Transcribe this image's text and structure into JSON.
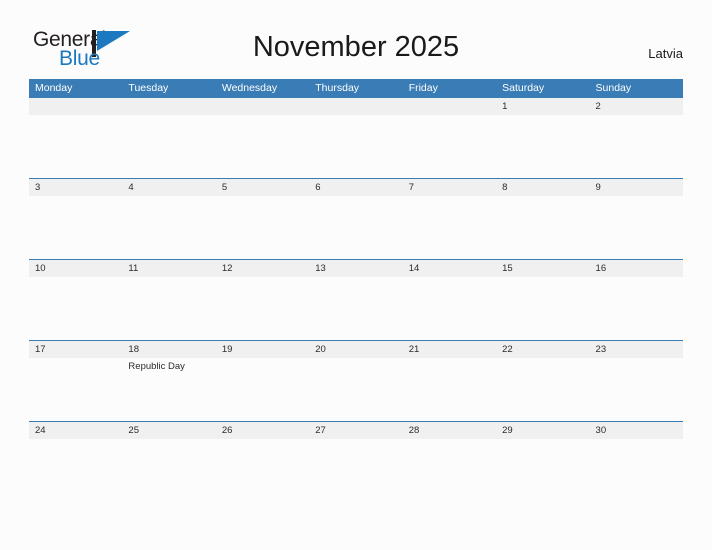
{
  "brand": {
    "name_dark": "General",
    "name_blue": "Blue",
    "accent_color": "#1c79c0",
    "mark_icon": "triangle-flag-icon"
  },
  "header": {
    "title": "November 2025",
    "country": "Latvia"
  },
  "colors": {
    "header_bar": "#3a7cb5",
    "date_band": "#f0f0f0",
    "page_background": "#fcfcfd",
    "text": "#2b2b2b"
  },
  "calendar": {
    "weekdays": [
      "Monday",
      "Tuesday",
      "Wednesday",
      "Thursday",
      "Friday",
      "Saturday",
      "Sunday"
    ],
    "weeks": [
      [
        {
          "date": "",
          "event": ""
        },
        {
          "date": "",
          "event": ""
        },
        {
          "date": "",
          "event": ""
        },
        {
          "date": "",
          "event": ""
        },
        {
          "date": "",
          "event": ""
        },
        {
          "date": "1",
          "event": ""
        },
        {
          "date": "2",
          "event": ""
        }
      ],
      [
        {
          "date": "3",
          "event": ""
        },
        {
          "date": "4",
          "event": ""
        },
        {
          "date": "5",
          "event": ""
        },
        {
          "date": "6",
          "event": ""
        },
        {
          "date": "7",
          "event": ""
        },
        {
          "date": "8",
          "event": ""
        },
        {
          "date": "9",
          "event": ""
        }
      ],
      [
        {
          "date": "10",
          "event": ""
        },
        {
          "date": "11",
          "event": ""
        },
        {
          "date": "12",
          "event": ""
        },
        {
          "date": "13",
          "event": ""
        },
        {
          "date": "14",
          "event": ""
        },
        {
          "date": "15",
          "event": ""
        },
        {
          "date": "16",
          "event": ""
        }
      ],
      [
        {
          "date": "17",
          "event": ""
        },
        {
          "date": "18",
          "event": "Republic Day"
        },
        {
          "date": "19",
          "event": ""
        },
        {
          "date": "20",
          "event": ""
        },
        {
          "date": "21",
          "event": ""
        },
        {
          "date": "22",
          "event": ""
        },
        {
          "date": "23",
          "event": ""
        }
      ],
      [
        {
          "date": "24",
          "event": ""
        },
        {
          "date": "25",
          "event": ""
        },
        {
          "date": "26",
          "event": ""
        },
        {
          "date": "27",
          "event": ""
        },
        {
          "date": "28",
          "event": ""
        },
        {
          "date": "29",
          "event": ""
        },
        {
          "date": "30",
          "event": ""
        }
      ]
    ]
  }
}
